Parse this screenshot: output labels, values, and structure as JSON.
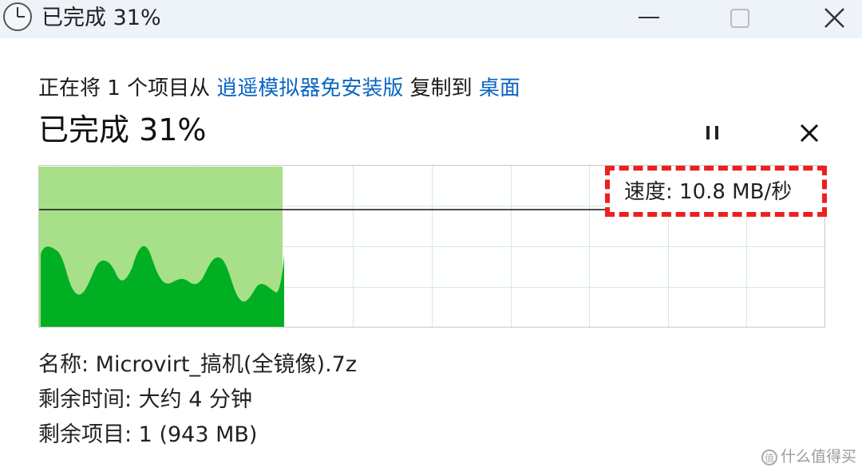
{
  "window": {
    "title": "已完成 31%",
    "icons": {
      "app": "clock-icon",
      "minimize": "minimize-icon",
      "maximize": "maximize-icon",
      "close": "close-icon"
    }
  },
  "operation": {
    "prefix": "正在将 1 个项目从 ",
    "source": "逍遥模拟器免安装版",
    "middle": " 复制到 ",
    "destination": "桌面",
    "percent_text": "已完成 31%",
    "progress": 0.31,
    "icons": {
      "pause": "pause-icon",
      "cancel": "close-icon"
    },
    "link_color": "#0a66c2"
  },
  "speed": {
    "label": "速度: 10.8 MB/秒",
    "highlight_color": "#ee1f1f"
  },
  "graph": {
    "fill_color": "#00b022",
    "progress_color": "#a8e08a",
    "grid_color": "#d4ecd4"
  },
  "details": {
    "name": "名称: Microvirt_搞机(全镜像).7z",
    "time_left": "剩余时间: 大约 4 分钟",
    "items_left": "剩余项目: 1 (943 MB)"
  },
  "watermark": {
    "text": "什么值得买"
  }
}
